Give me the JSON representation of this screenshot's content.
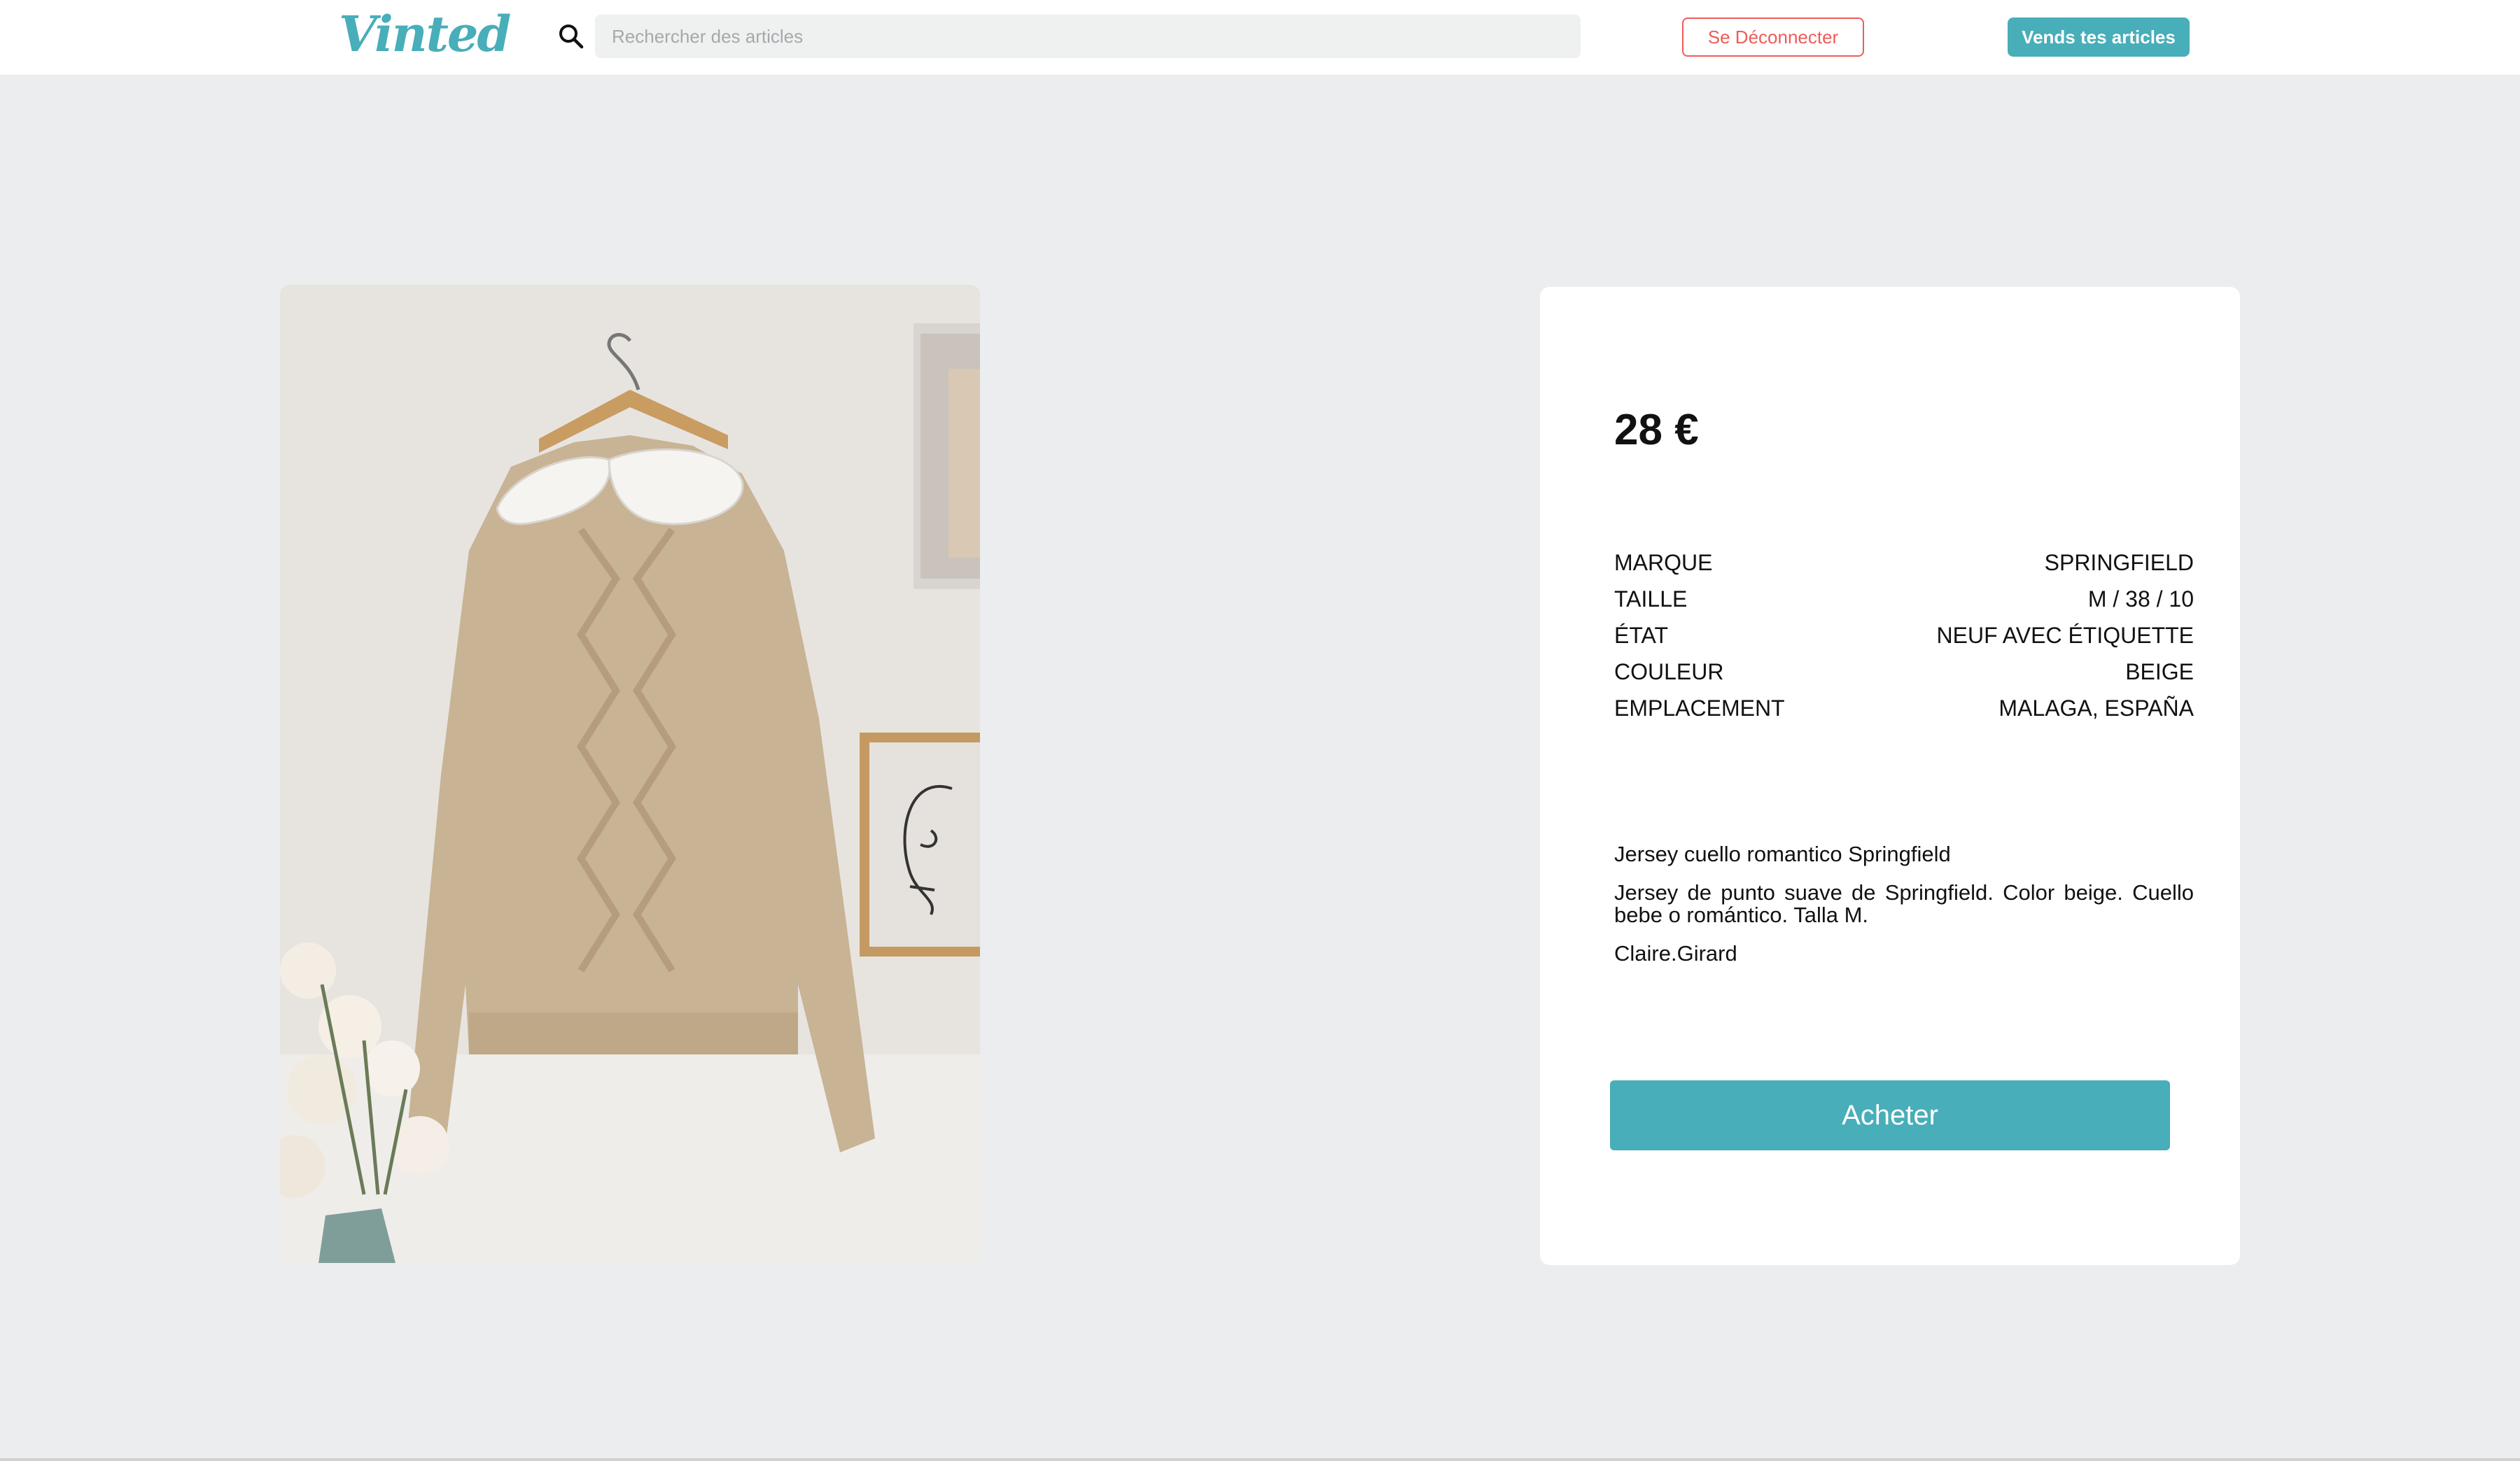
{
  "header": {
    "logo_text": "Vinted",
    "search_placeholder": "Rechercher des articles",
    "logout_label": "Se Déconnecter",
    "sell_label": "Vends tes articles"
  },
  "product": {
    "photo_icon": "product-photo",
    "price": "28 €",
    "attributes": [
      {
        "label": "MARQUE",
        "value": "SPRINGFIELD"
      },
      {
        "label": "TAILLE",
        "value": "M / 38 / 10"
      },
      {
        "label": "ÉTAT",
        "value": "NEUF AVEC ÉTIQUETTE"
      },
      {
        "label": "COULEUR",
        "value": "BEIGE"
      },
      {
        "label": "EMPLACEMENT",
        "value": "MALAGA, ESPAÑA"
      }
    ],
    "title": "Jersey cuello romantico Springfield",
    "description": "Jersey de punto suave de Springfield. Color beige. Cuello bebe o romántico. Talla M.",
    "seller": "Claire.Girard",
    "buy_label": "Acheter"
  },
  "colors": {
    "accent": "#48aeb9",
    "danger": "#ef5b58",
    "page_background": "#ebedee"
  }
}
